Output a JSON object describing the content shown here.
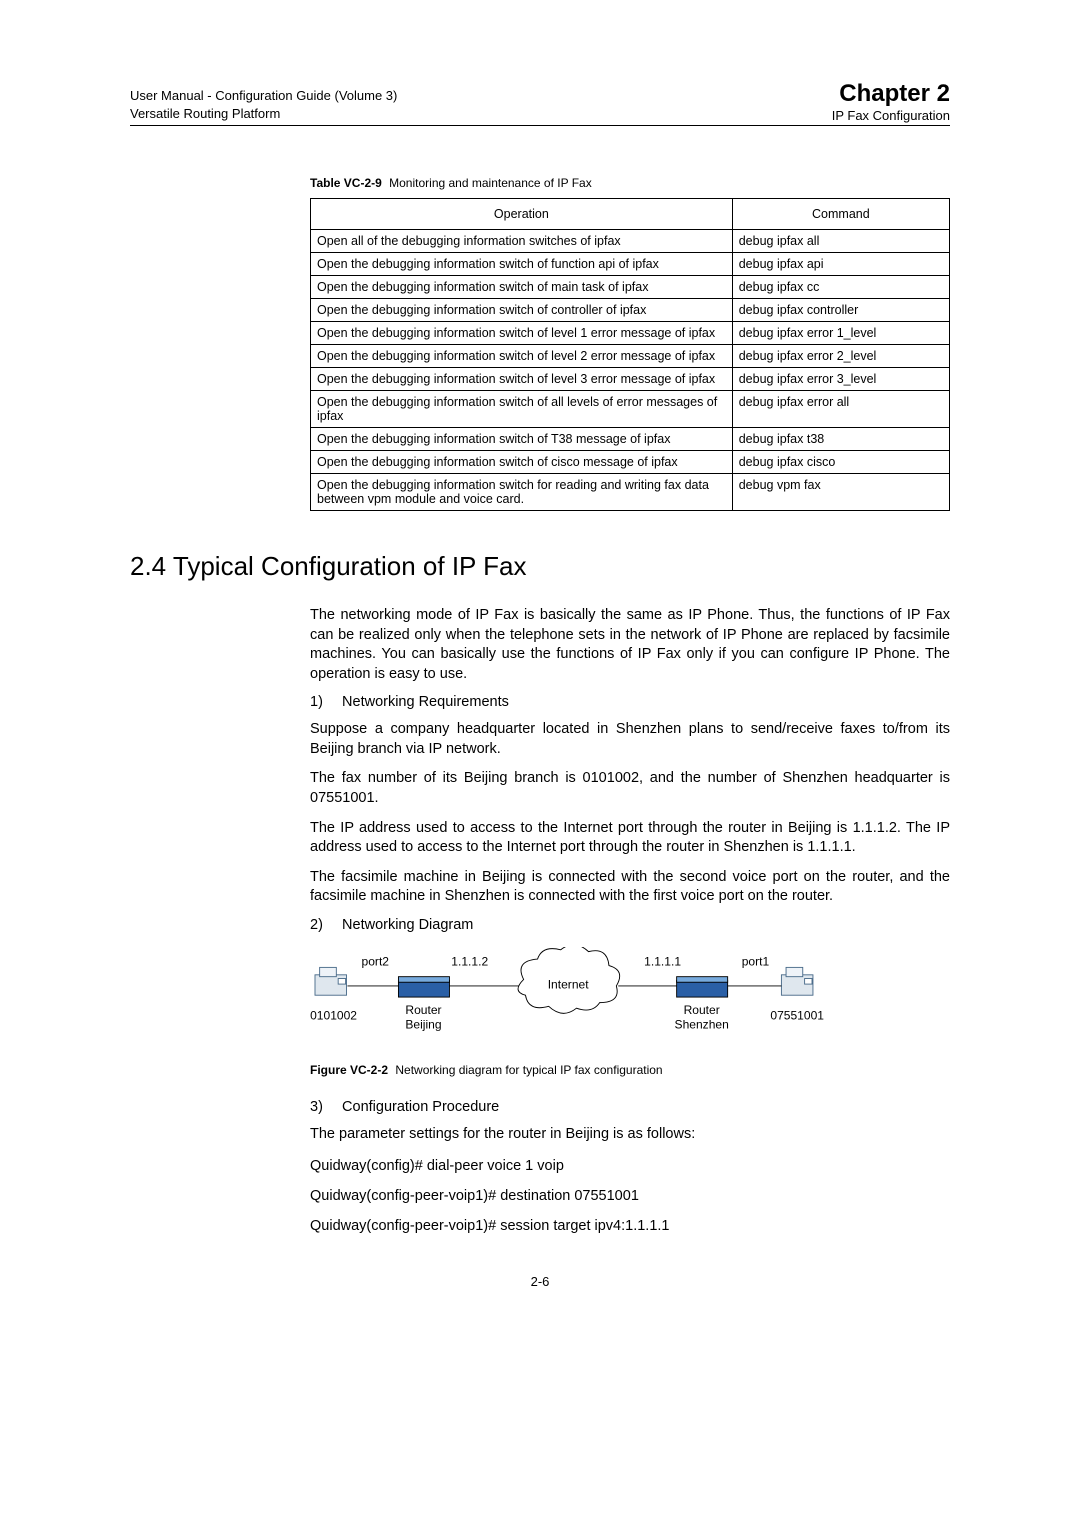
{
  "header": {
    "left_line1": "User Manual - Configuration Guide (Volume 3)",
    "left_line2": "Versatile Routing Platform",
    "chapter": "Chapter 2",
    "subtitle": "IP Fax Configuration"
  },
  "table": {
    "caption_label": "Table VC-2-9",
    "caption_text": "Monitoring and maintenance of IP Fax",
    "head_op": "Operation",
    "head_cmd": "Command",
    "rows": [
      {
        "op": "Open all of the debugging information switches of ipfax",
        "cmd": "debug ipfax all"
      },
      {
        "op": "Open the debugging information switch of function api of ipfax",
        "cmd": "debug ipfax api"
      },
      {
        "op": "Open the debugging information switch of main task of ipfax",
        "cmd": "debug ipfax cc"
      },
      {
        "op": "Open the debugging information switch of controller of ipfax",
        "cmd": "debug ipfax controller"
      },
      {
        "op": "Open the debugging information switch of level 1 error message of ipfax",
        "cmd": "debug ipfax error 1_level"
      },
      {
        "op": "Open the debugging information switch of level 2 error message of ipfax",
        "cmd": "debug ipfax error 2_level"
      },
      {
        "op": "Open the debugging information switch of level 3 error message of ipfax",
        "cmd": "debug ipfax error 3_level"
      },
      {
        "op": "Open the debugging information switch of all levels of error messages of ipfax",
        "cmd": "debug ipfax error all"
      },
      {
        "op": "Open the debugging information switch of T38 message of ipfax",
        "cmd": "debug ipfax t38"
      },
      {
        "op": "Open the debugging information switch of cisco message of ipfax",
        "cmd": "debug ipfax cisco"
      },
      {
        "op": "Open the debugging information switch for reading and writing fax data between vpm module and voice card.",
        "cmd": "debug vpm fax"
      }
    ]
  },
  "section": {
    "title": "2.4  Typical Configuration of IP Fax"
  },
  "paragraphs": {
    "p1": "The networking mode of IP Fax is basically the same as IP Phone. Thus, the functions of IP Fax can be realized only when the telephone sets in the network of IP Phone are replaced by facsimile machines. You can basically use the functions of IP Fax only if you can configure IP Phone. The operation is easy to use.",
    "item1_num": "1)",
    "item1_label": "Networking Requirements",
    "p2": "Suppose a company headquarter located in Shenzhen plans to send/receive faxes to/from its Beijing branch via IP network.",
    "p3": "The fax number of its Beijing branch is 0101002, and the number of Shenzhen headquarter is 07551001.",
    "p4": "The IP address used to access to the Internet port through the router in Beijing is 1.1.1.2. The IP address used to access to the Internet port through the router in Shenzhen is 1.1.1.1.",
    "p5": "The facsimile machine in Beijing is connected with the second voice port on the router, and the facsimile machine in Shenzhen is connected with the first voice port on the router.",
    "item2_num": "2)",
    "item2_label": "Networking Diagram",
    "item3_num": "3)",
    "item3_label": "Configuration Procedure",
    "p6": "The parameter settings for the router in Beijing is as follows:"
  },
  "diagram": {
    "port2": "port2",
    "ip_left": "1.1.1.2",
    "internet": "Internet",
    "ip_right": "1.1.1.1",
    "port1": "port1",
    "fax_left": "0101002",
    "router_left_l1": "Router",
    "router_left_l2": "Beijing",
    "router_right_l1": "Router",
    "router_right_l2": "Shenzhen",
    "fax_right": "07551001"
  },
  "figure": {
    "caption_label": "Figure VC-2-2",
    "caption_text": "Networking diagram for typical IP fax configuration"
  },
  "config": {
    "l1": "Quidway(config)# dial-peer voice 1 voip",
    "l2": "Quidway(config-peer-voip1)# destination 07551001",
    "l3": "Quidway(config-peer-voip1)# session target ipv4:1.1.1.1"
  },
  "footer": {
    "page": "2-6"
  }
}
